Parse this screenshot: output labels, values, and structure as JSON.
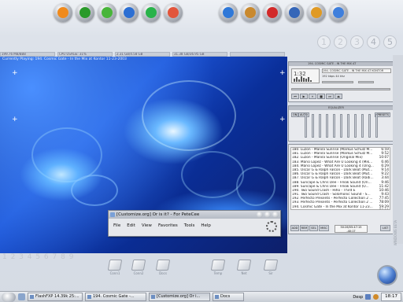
{
  "top_dock": {
    "left": [
      {
        "name": "runner-icon",
        "color": "#f08a1c"
      },
      {
        "name": "monitor-icon",
        "color": "#2a9a2a"
      },
      {
        "name": "icq-flower-icon",
        "color": "#48b53a"
      },
      {
        "name": "browser-e-icon",
        "color": "#2c6fd3"
      },
      {
        "name": "x-app-icon",
        "color": "#29b34a"
      },
      {
        "name": "winamp-icon",
        "color": "#e2553b"
      }
    ],
    "right": [
      {
        "name": "network-users-icon",
        "color": "#2f78d8"
      },
      {
        "name": "face-icon",
        "color": "#c9892e"
      },
      {
        "name": "compass-icon",
        "color": "#d22a2a"
      },
      {
        "name": "settings-icon",
        "color": "#3566b8"
      },
      {
        "name": "lightning-icon",
        "color": "#e09a24"
      },
      {
        "name": "play-icon",
        "color": "#3f7fdc"
      }
    ]
  },
  "desk_numbers": [
    "1",
    "2",
    "3",
    "4",
    "5"
  ],
  "stats_bar": [
    "199.76 MB/BB8",
    "CPU USAGE: 31%",
    "2.31 GB/4.58 GB",
    "31.38 GB/36.95 GB",
    ""
  ],
  "now_playing": "Currently Playing: 194. Cosmic Gate - In the Mix at Kontor 11-23-2003",
  "winamp": {
    "title": "194. COSMIC GATE - IN THE MIX AT",
    "time": "1:32",
    "bitrate": "192",
    "khz": "44",
    "kbps_label": "kbps",
    "khz_label": "khz",
    "info_line": "194. COSMIC GATE - IN THE MIX AT KONTOR",
    "controls": [
      "⏮",
      "▶",
      "⏸",
      "■",
      "⏭",
      "⏏"
    ]
  },
  "equalizer": {
    "title": "EQUALIZER",
    "on_label": "ON",
    "auto_label": "AUTO",
    "presets_label": "PRESETS"
  },
  "playlist": {
    "items": [
      {
        "text": "180. Luzon - Manila Sunrise (Markus Schulz M...",
        "dur": "6:59"
      },
      {
        "text": "181. Luzon - Manila Sunrise (Markus Schulz M...",
        "dur": "9:52"
      },
      {
        "text": "182. Luzon - Manila Sunrise (Original Mix)",
        "dur": "10:07"
      },
      {
        "text": "183. Mario Lopez - What Are U Looking 4 (Mik...",
        "dur": "6:46"
      },
      {
        "text": "184. Mario Lopez - What Are U Looking 4 (Orig...",
        "dur": "6:29"
      },
      {
        "text": "185. Oscar G & Ralph Falcon - Dark Beat (Mut...",
        "dur": "9:14"
      },
      {
        "text": "186. Oscar G & Ralph Falcon - Dark Beat (Mut...",
        "dur": "9:22"
      },
      {
        "text": "187. Oscar G & Ralph Falcon - Dark Beat (Radi...",
        "dur": "3:44"
      },
      {
        "text": "188. Suncape & Chris Dee - Freak Sound (Ori...",
        "dur": "9:46"
      },
      {
        "text": "189. Suncape & Chris Dee - Freak Sound (O...",
        "dur": "11:42"
      },
      {
        "text": "190. Two Sound Clash - Hiho - Third E",
        "dur": "10:46"
      },
      {
        "text": "191. Two Sound Clash - Solomonic Sound - S...",
        "dur": "9:43"
      },
      {
        "text": "192. Perfecto Presents - Perfecto Collection 2 ...",
        "dur": "77:45"
      },
      {
        "text": "193. Perfecto Presents - Perfecto Collection 2 ...",
        "dur": "78:09"
      },
      {
        "text": "194. Cosmic Gate - In the Mix at Kontor 11-23...",
        "dur": "59:29"
      },
      {
        "text": "195. VA - CD1 mixed by Markus Gardeweg",
        "dur": "76:12"
      }
    ],
    "buttons": {
      "add": "ADD",
      "rem": "REM",
      "sel": "SEL",
      "misc": "MISC",
      "list": "LIST"
    },
    "total_time": "50:26/55:47:15",
    "elapsed": "-40:17"
  },
  "ie_window": {
    "title": "[Customize.org] Or is it? - For PeteCee",
    "menu": [
      "File",
      "Edit",
      "View",
      "Favorites",
      "Tools",
      "Help"
    ]
  },
  "bottom_numbers": "1 2 3 4 5 6 7 8 9",
  "launchers": [
    {
      "label": "Conn1",
      "name": "conn1-launcher"
    },
    {
      "label": "Conn2",
      "name": "conn2-launcher"
    },
    {
      "label": "Docs",
      "name": "docs-launcher"
    },
    {
      "label": "Temp",
      "name": "temp-launcher"
    },
    {
      "label": "Net",
      "name": "net-launcher"
    },
    {
      "label": "Sir",
      "name": "sir-launcher"
    }
  ],
  "side_text": "WINDOWS BETA",
  "taskbar": {
    "tasks": [
      {
        "label": "FlashFXP 14.39k 25:..."
      },
      {
        "label": "194. Cosmic Gate -..."
      },
      {
        "label": "[Customize.org] Or i..."
      },
      {
        "label": "Docs"
      }
    ],
    "desk_label": "Desp",
    "clock": "18:17"
  }
}
